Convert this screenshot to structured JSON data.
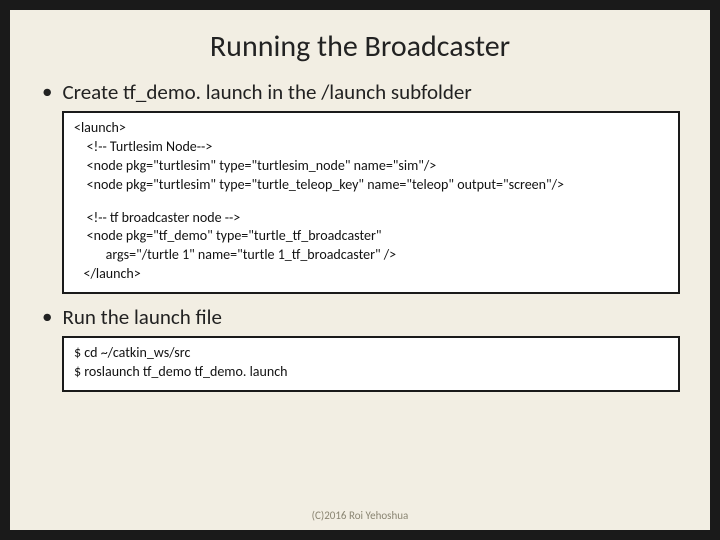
{
  "title": "Running the Broadcaster",
  "bullet1": "Create tf_demo. launch in the /launch subfolder",
  "code1": {
    "l1": "<launch>",
    "l2": "    <!-- Turtlesim Node-->",
    "l3": "    <node pkg=\"turtlesim\" type=\"turtlesim_node\" name=\"sim\"/>",
    "l4": "    <node pkg=\"turtlesim\" type=\"turtle_teleop_key\" name=\"teleop\" output=\"screen\"/>",
    "l5": "    <!-- tf broadcaster node -->",
    "l6": "    <node pkg=\"tf_demo\" type=\"turtle_tf_broadcaster\"",
    "l7": "          args=\"/turtle 1\" name=\"turtle 1_tf_broadcaster\" />",
    "l8": "   </launch>"
  },
  "bullet2": "Run the launch file",
  "code2": {
    "l1": "$ cd ~/catkin_ws/src",
    "l2": "$ roslaunch tf_demo tf_demo. launch"
  },
  "footer": "(C)2016 Roi Yehoshua"
}
